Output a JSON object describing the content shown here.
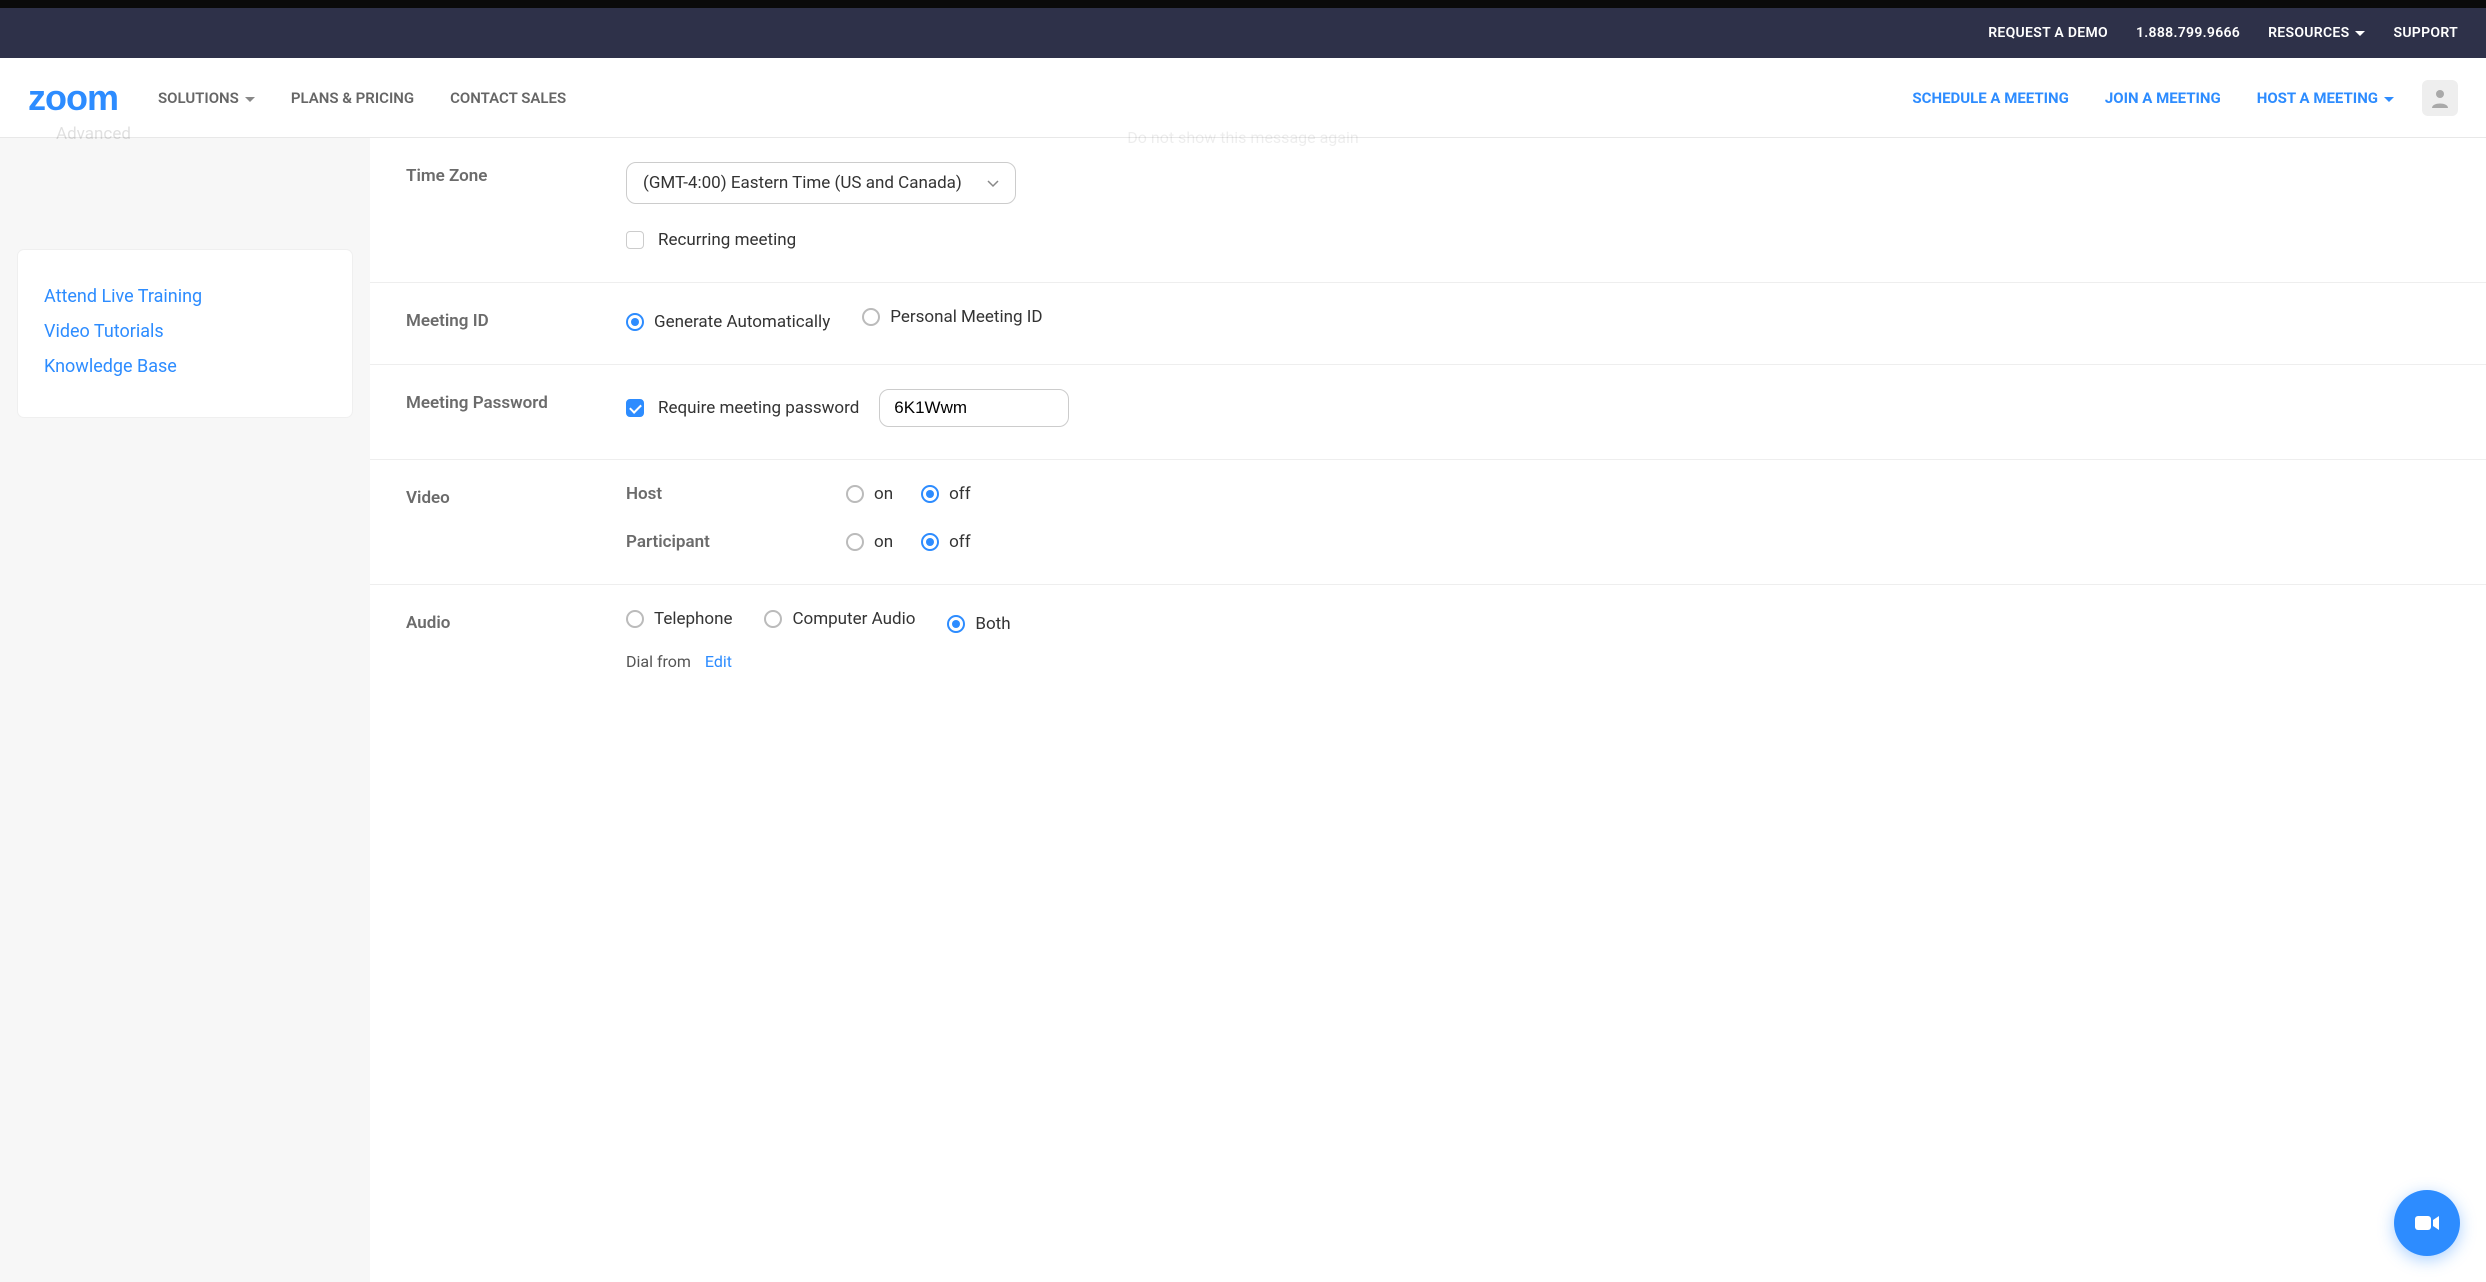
{
  "topbar": {
    "request_demo": "REQUEST A DEMO",
    "phone": "1.888.799.9666",
    "resources": "RESOURCES",
    "support": "SUPPORT"
  },
  "nav": {
    "logo_text": "zoom",
    "solutions": "SOLUTIONS",
    "plans": "PLANS & PRICING",
    "contact": "CONTACT SALES",
    "schedule": "SCHEDULE A MEETING",
    "join": "JOIN A MEETING",
    "host": "HOST A MEETING"
  },
  "ghost": {
    "notice": "Do not show this message again",
    "sidebar_item": "Advanced"
  },
  "sidebar": {
    "links": [
      "Attend Live Training",
      "Video Tutorials",
      "Knowledge Base"
    ]
  },
  "form": {
    "timezone": {
      "label": "Time Zone",
      "value": "(GMT-4:00) Eastern Time (US and Canada)",
      "recurring_label": "Recurring meeting",
      "recurring_checked": false
    },
    "meeting_id": {
      "label": "Meeting ID",
      "opt_auto": "Generate Automatically",
      "opt_pmi": "Personal Meeting ID",
      "selected": "auto"
    },
    "password": {
      "label": "Meeting Password",
      "require_label": "Require meeting password",
      "require_checked": true,
      "value": "6K1Wwm"
    },
    "video": {
      "label": "Video",
      "host_label": "Host",
      "participant_label": "Participant",
      "on": "on",
      "off": "off",
      "host_selected": "off",
      "participant_selected": "off"
    },
    "audio": {
      "label": "Audio",
      "opt_tel": "Telephone",
      "opt_comp": "Computer Audio",
      "opt_both": "Both",
      "selected": "both",
      "dial_label": "Dial from",
      "edit": "Edit"
    }
  }
}
